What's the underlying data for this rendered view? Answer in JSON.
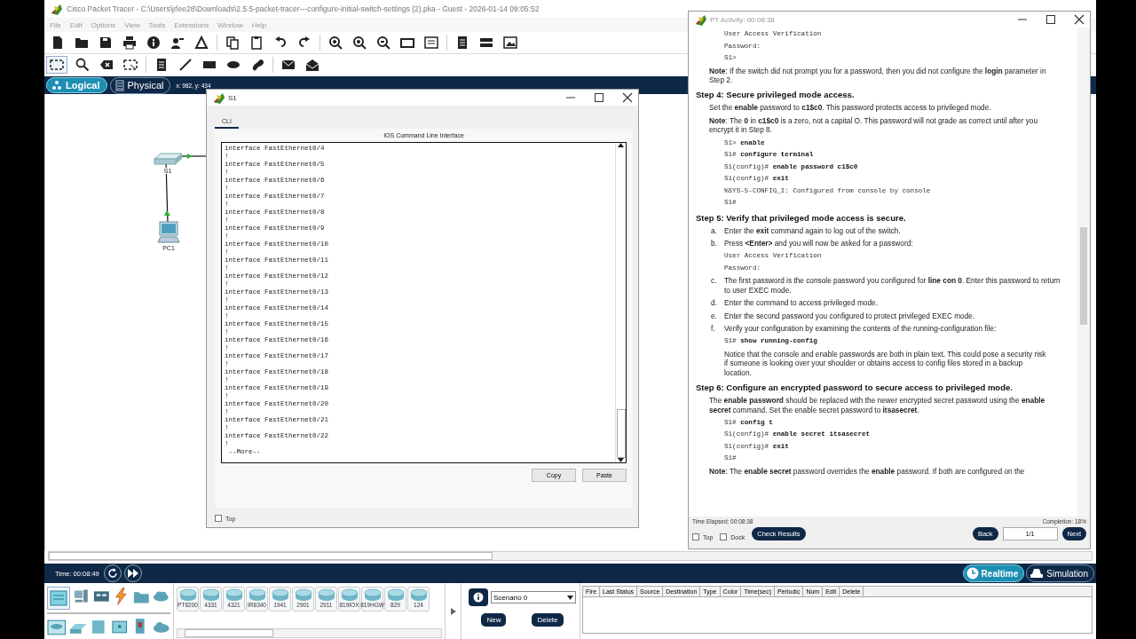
{
  "app": {
    "title": "Cisco Packet Tracer - C:\\Users\\jrlee28\\Downloads\\2.5.5-packet-tracer---configure-initial-switch-settings (2).pka - Guest - 2026-01-14 09:05:52",
    "menu": [
      "File",
      "Edit",
      "Options",
      "View",
      "Tools",
      "Extensions",
      "Window",
      "Help"
    ],
    "views": [
      {
        "label": "Logical",
        "selected": true
      },
      {
        "label": "Physical",
        "selected": false
      }
    ],
    "coords": "x: 982, y: 434"
  },
  "topology": {
    "devices": [
      {
        "kind": "switch",
        "label": "S1"
      },
      {
        "kind": "pc",
        "label": "PC1"
      }
    ]
  },
  "timebar": {
    "time": "Time: 00:08:49",
    "modes": [
      {
        "label": "Realtime",
        "selected": true
      },
      {
        "label": "Simulation",
        "selected": false
      }
    ]
  },
  "device_panel": {
    "models": [
      "PT8200",
      "4331",
      "4321",
      "IR8340",
      "1941",
      "2901",
      "2911",
      "819IOX",
      "819HGW",
      "829",
      "124"
    ]
  },
  "scenario": {
    "value": "Scenario 0",
    "buttons": [
      "New",
      "Delete"
    ]
  },
  "pdu_table": {
    "columns": [
      "Fire",
      "Last Status",
      "Source",
      "Destination",
      "Type",
      "Color",
      "Time(sec)",
      "Periodic",
      "Num",
      "Edit",
      "Delete"
    ]
  },
  "cli_window": {
    "title": "S1",
    "tabs": [
      {
        "label": "CLI",
        "selected": true
      }
    ],
    "heading": "IOS Command Line Interface",
    "lines": [
      "interface FastEthernet0/4",
      "!",
      "interface FastEthernet0/5",
      "!",
      "interface FastEthernet0/6",
      "!",
      "interface FastEthernet0/7",
      "!",
      "interface FastEthernet0/8",
      "!",
      "interface FastEthernet0/9",
      "!",
      "interface FastEthernet0/10",
      "!",
      "interface FastEthernet0/11",
      "!",
      "interface FastEthernet0/12",
      "!",
      "interface FastEthernet0/13",
      "!",
      "interface FastEthernet0/14",
      "!",
      "interface FastEthernet0/15",
      "!",
      "interface FastEthernet0/16",
      "!",
      "interface FastEthernet0/17",
      "!",
      "interface FastEthernet0/18",
      "!",
      "interface FastEthernet0/19",
      "!",
      "interface FastEthernet0/20",
      "!",
      "interface FastEthernet0/21",
      "!",
      "interface FastEthernet0/22",
      "!",
      " --More--"
    ],
    "buttons": [
      "Copy",
      "Paste"
    ],
    "top": {
      "label": "Top",
      "checked": false
    }
  },
  "activity": {
    "title": "PT Activity: 00:08:38",
    "blocks": [
      {
        "kind": "code",
        "lines": [
          "User Access Verification",
          "Password:",
          "S1>"
        ]
      },
      {
        "kind": "para",
        "text": "**Note**: If the switch did not prompt you for a password, then you did not configure the **login** parameter in Step 2."
      },
      {
        "kind": "heading",
        "text": "Step 4: Secure privileged mode access."
      },
      {
        "kind": "para",
        "text": "Set the **enable** password to **c1$c0**. This password protects access to privileged mode."
      },
      {
        "kind": "para",
        "text": "**Note**: The **0** in **c1$c0** is a zero, not a capital O. This password will not grade as correct until after you encrypt it in Step 8."
      },
      {
        "kind": "code",
        "lines": [
          "S1> **enable**",
          "S1# **configure terminal**",
          "S1(config)# **enable password c1$c0**",
          "S1(config)# **exit**",
          "%SYS-5-CONFIG_I: Configured from console by console",
          "S1#"
        ]
      },
      {
        "kind": "heading",
        "text": "Step 5: Verify that privileged mode access is secure."
      },
      {
        "kind": "item",
        "marker": "a.",
        "text": "Enter the **exit** command again to log out of the switch."
      },
      {
        "kind": "item",
        "marker": "b.",
        "text": "Press **<Enter>** and you will now be asked for a password:"
      },
      {
        "kind": "code",
        "lines": [
          "User Access Verification",
          "Password:"
        ]
      },
      {
        "kind": "item",
        "marker": "c.",
        "text": "The first password is the console password you configured for **line con 0**. Enter this password to return to user EXEC mode."
      },
      {
        "kind": "item",
        "marker": "d.",
        "text": "Enter the command to access privileged mode."
      },
      {
        "kind": "item",
        "marker": "e.",
        "text": "Enter the second password you configured to protect privileged EXEC mode."
      },
      {
        "kind": "item",
        "marker": "f.",
        "text": "Verify your configuration by examining the contents of the running-configuration file:"
      },
      {
        "kind": "code",
        "lines": [
          "S1# **show running-config**"
        ]
      },
      {
        "kind": "subpara",
        "text": "Notice that the console and enable passwords are both in plain text. This could pose a security risk if someone is looking over your shoulder or obtains access to config files stored in a backup location."
      },
      {
        "kind": "heading",
        "text": "Step 6: Configure an encrypted password to secure access to privileged mode."
      },
      {
        "kind": "para",
        "text": "The **enable password** should be replaced with the newer encrypted secret password using the **enable secret** command. Set the enable secret password to **itsasecret**."
      },
      {
        "kind": "code",
        "lines": [
          "S1# **config t**",
          "S1(config)# **enable secret itsasecret**",
          "S1(config)# **exit**",
          "S1#"
        ]
      },
      {
        "kind": "para",
        "text": "**Note**: The **enable secret** password overrides the **enable** password. If both are configured on the"
      }
    ],
    "time_elapsed": "Time Elapsed: 00:08:38",
    "completion": "Completion: 18%",
    "checks": [
      {
        "label": "Top",
        "checked": false
      },
      {
        "label": "Dock",
        "checked": false
      }
    ],
    "check_button": "Check Results",
    "back": "Back",
    "page": "1/1",
    "next": "Next"
  }
}
